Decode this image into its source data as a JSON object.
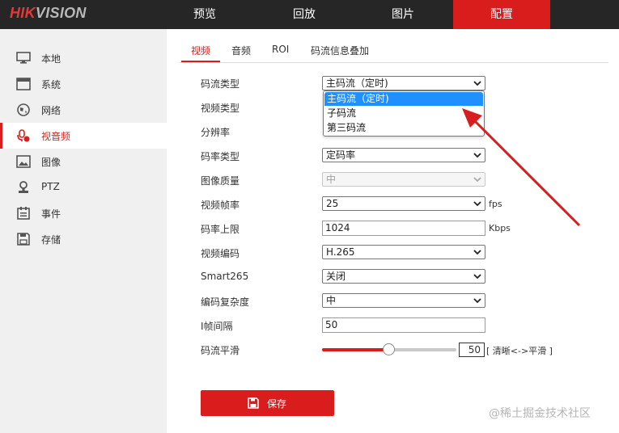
{
  "brand": {
    "logo_main": "HIK",
    "logo_dim": "VISION"
  },
  "nav": [
    "预览",
    "回放",
    "图片",
    "配置"
  ],
  "sidebar": [
    {
      "label": "本地",
      "icon": "monitor-icon"
    },
    {
      "label": "系统",
      "icon": "window-icon"
    },
    {
      "label": "网络",
      "icon": "globe-icon"
    },
    {
      "label": "视音频",
      "icon": "microphone-icon"
    },
    {
      "label": "图像",
      "icon": "image-icon"
    },
    {
      "label": "PTZ",
      "icon": "ptz-icon"
    },
    {
      "label": "事件",
      "icon": "calendar-icon"
    },
    {
      "label": "存储",
      "icon": "save-icon"
    }
  ],
  "tabs": [
    "视频",
    "音频",
    "ROI",
    "码流信息叠加"
  ],
  "form": {
    "stream_type": {
      "label": "码流类型",
      "value": "主码流（定时)"
    },
    "video_type": {
      "label": "视频类型"
    },
    "resolution": {
      "label": "分辨率"
    },
    "bitrate_type": {
      "label": "码率类型",
      "value": "定码率"
    },
    "image_quality": {
      "label": "图像质量",
      "value": "中"
    },
    "frame_rate": {
      "label": "视频帧率",
      "value": "25",
      "unit": "fps"
    },
    "max_bitrate": {
      "label": "码率上限",
      "value": "1024",
      "unit": "Kbps"
    },
    "video_encoding": {
      "label": "视频编码",
      "value": "H.265"
    },
    "smart265": {
      "label": "Smart265",
      "value": "关闭"
    },
    "encoding_complexity": {
      "label": "编码复杂度",
      "value": "中"
    },
    "i_frame_interval": {
      "label": "I帧间隔",
      "value": "50"
    },
    "stream_smoothing": {
      "label": "码流平滑",
      "value": "50",
      "hint": "[ 清晰<->平滑 ]"
    }
  },
  "stream_type_options": [
    "主码流（定时)",
    "子码流",
    "第三码流"
  ],
  "save_label": "保存",
  "watermark": "@稀土掘金技术社区",
  "colors": {
    "accent": "#d91d1d",
    "topbar": "#262626",
    "highlight": "#1e90ff"
  }
}
